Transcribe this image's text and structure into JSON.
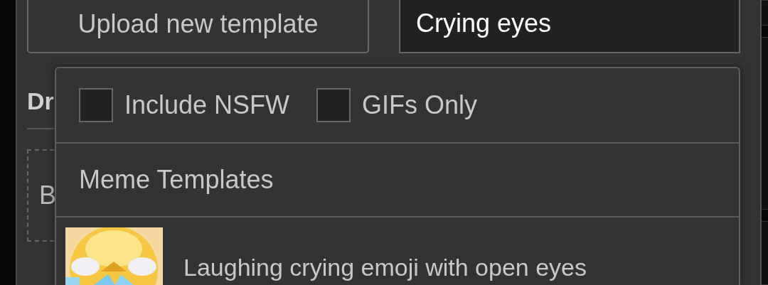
{
  "upload_button": {
    "label": "Upload new template"
  },
  "search_field": {
    "value": "Crying eyes"
  },
  "section_heading": "Dr",
  "drop_zone": {
    "text": "B"
  },
  "dropdown": {
    "filters": [
      {
        "label": "Include NSFW",
        "checked": false
      },
      {
        "label": "GIFs Only",
        "checked": false
      }
    ],
    "section_title": "Meme Templates",
    "results": [
      {
        "title": "Laughing crying emoji with open eyes"
      }
    ]
  }
}
